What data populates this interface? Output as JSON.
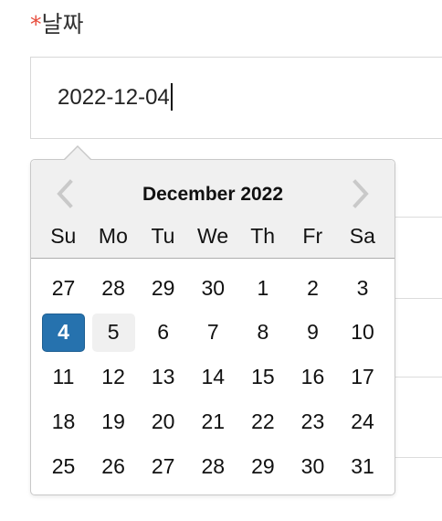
{
  "form": {
    "required_mark": "*",
    "label": "날짜",
    "value": "2022-12-04"
  },
  "datepicker": {
    "month_title": "December 2022",
    "prev_icon": "chevron-left-icon",
    "next_icon": "chevron-right-icon",
    "weekdays": [
      "Su",
      "Mo",
      "Tu",
      "We",
      "Th",
      "Fr",
      "Sa"
    ],
    "days": [
      "27",
      "28",
      "29",
      "30",
      "1",
      "2",
      "3",
      "4",
      "5",
      "6",
      "7",
      "8",
      "9",
      "10",
      "11",
      "12",
      "13",
      "14",
      "15",
      "16",
      "17",
      "18",
      "19",
      "20",
      "21",
      "22",
      "23",
      "24",
      "25",
      "26",
      "27",
      "28",
      "29",
      "30",
      "31"
    ],
    "selected_day": "4",
    "hovered_day": "5"
  },
  "colors": {
    "required": "#e74c3c",
    "selected_day": "#2672ae",
    "header_background": "#f0f0f0",
    "nav_arrow": "#c9c9c9"
  }
}
